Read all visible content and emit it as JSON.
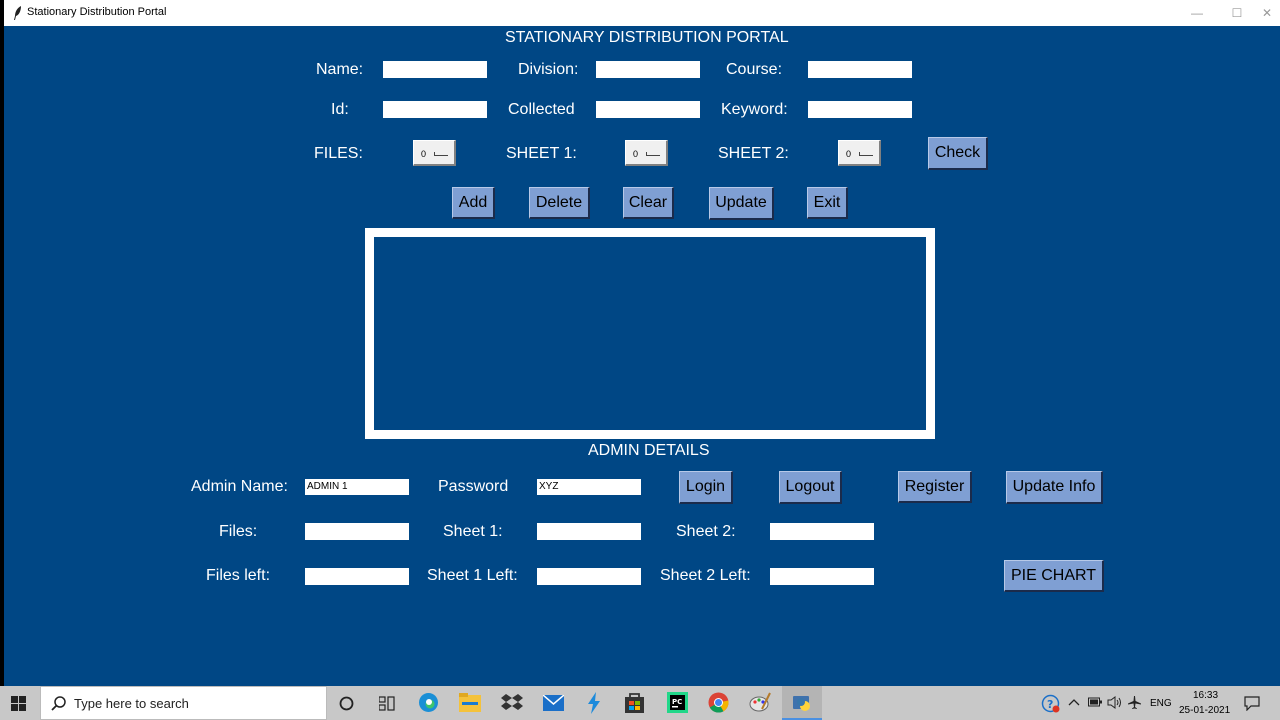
{
  "window": {
    "title": "Stationary Distribution Portal",
    "controls": {
      "minimize": "—",
      "maximize": "☐",
      "close": "✕"
    }
  },
  "header": {
    "title": "STATIONARY DISTRIBUTION PORTAL"
  },
  "form": {
    "name_label": "Name:",
    "division_label": "Division:",
    "course_label": "Course:",
    "id_label": "Id:",
    "collected_label": "Collected",
    "keyword_label": "Keyword:",
    "files_label": "FILES:",
    "sheet1_label": "SHEET 1:",
    "sheet2_label": "SHEET 2:",
    "files_value": "0",
    "sheet1_value": "0",
    "sheet2_value": "0",
    "check_button": "Check"
  },
  "actions": {
    "add": "Add",
    "delete": "Delete",
    "clear": "Clear",
    "update": "Update",
    "exit": "Exit"
  },
  "admin": {
    "section_title": "ADMIN DETAILS",
    "admin_name_label": "Admin Name:",
    "admin_name_value": "ADMIN 1",
    "password_label": "Password",
    "password_value": "XYZ",
    "login": "Login",
    "logout": "Logout",
    "register": "Register",
    "update_info": "Update Info",
    "files_label": "Files:",
    "sheet1_label": "Sheet 1:",
    "sheet2_label": "Sheet 2:",
    "files_left_label": "Files left:",
    "sheet1_left_label": "Sheet 1 Left:",
    "sheet2_left_label": "Sheet 2 Left:",
    "pie_chart": "PIE CHART"
  },
  "taskbar": {
    "search_placeholder": "Type here to search",
    "icons": [
      "windows-start-icon",
      "search-icon",
      "cortana-icon",
      "task-view-icon",
      "edge-icon",
      "file-explorer-icon",
      "dropbox-icon",
      "mail-icon",
      "visual-studio-icon",
      "store-icon",
      "pycharm-icon",
      "chrome-icon",
      "paint-icon",
      "python-icon"
    ],
    "language": "ENG",
    "time": "16:33",
    "date": "25-01-2021"
  },
  "colors": {
    "window_bg": "#004785",
    "button_bg": "#7f9fd3",
    "taskbar_bg": "#c8c8c8"
  }
}
